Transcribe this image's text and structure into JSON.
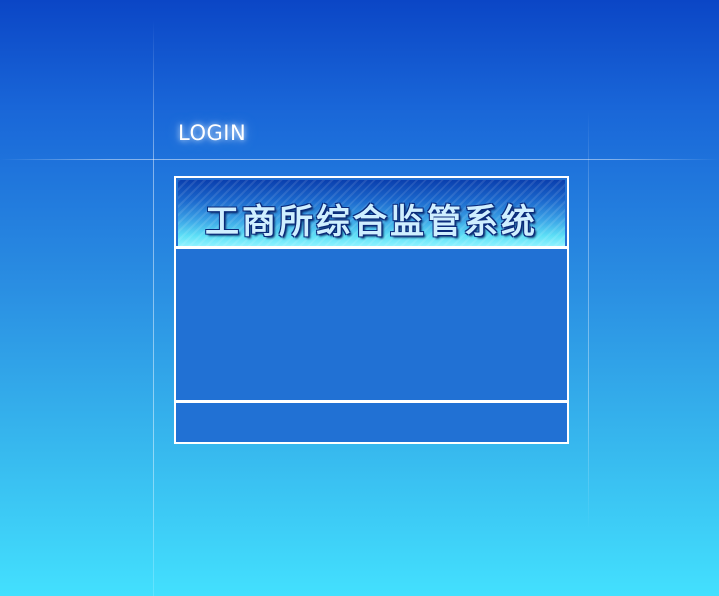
{
  "login": {
    "title": "LOGIN"
  },
  "panel": {
    "system_name": "工商所综合监管系统"
  },
  "colors": {
    "background_top": "#0b46c6",
    "background_bottom": "#43e0fe",
    "panel_fill": "#2171d4",
    "panel_border": "#ffffff"
  }
}
